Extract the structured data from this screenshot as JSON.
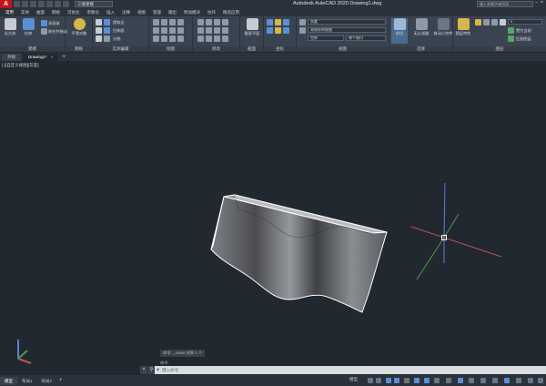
{
  "titlebar": {
    "logo": "A",
    "workspace": "三维建模",
    "title": "Autodesk AutoCAD 2020    Drawing1.dwg",
    "search_placeholder": "键入关键字或短语"
  },
  "ribbon_tabs": [
    "常用",
    "实体",
    "曲面",
    "网格",
    "可视化",
    "参数化",
    "插入",
    "注释",
    "视图",
    "管理",
    "输出",
    "附加模块",
    "协作",
    "精选应用"
  ],
  "ribbon": {
    "panels": [
      {
        "title": "建模",
        "buttons": [
          "长方体",
          "拉伸"
        ],
        "small": [
          "多段体",
          "按住并拖动"
        ]
      },
      {
        "title": "网格",
        "buttons": [
          "平滑对象"
        ]
      },
      {
        "title": "实体编辑",
        "small": [
          "提取边",
          "拉伸面",
          "分割"
        ]
      },
      {
        "title": "绘图"
      },
      {
        "title": "修改"
      },
      {
        "title": "截面",
        "buttons": [
          "截面平面"
        ]
      },
      {
        "title": "坐标"
      },
      {
        "title": "视图",
        "dropdowns": [
          "灰度",
          "未保存的视图",
          "世界",
          "单个视口"
        ]
      },
      {
        "title": "选择",
        "buttons": [
          "剖切",
          "无过滤器",
          "移动小控件"
        ]
      },
      {
        "title": "图层",
        "buttons": [
          "图层特性"
        ],
        "small": [
          "置为当前",
          "匹配图层"
        ],
        "dropdowns": [
          "0"
        ]
      }
    ]
  },
  "file_tabs": [
    {
      "label": "开始"
    },
    {
      "label": "Drawing1*",
      "close": "×"
    }
  ],
  "new_tab_symbol": "+",
  "viewport": {
    "label": "[-][自定义视图][灰度]"
  },
  "command": {
    "history_line": "命令: _.erase 找到 1 个",
    "history_line2": "命令:",
    "prompt_placeholder": "键入命令",
    "close_symbol": "×",
    "wrench_symbol": "⚲",
    "prompt_symbol": "▸"
  },
  "statusbar": {
    "tabs": [
      "模型",
      "布局1",
      "布局2"
    ],
    "add": "+",
    "model_label": "模型"
  },
  "colors": {
    "background": "#212830",
    "ribbon": "#3a4450",
    "accent_red": "#c0141b",
    "x_axis": "#c0525a",
    "y_axis": "#4f9a4f",
    "z_axis": "#5a7fd6"
  }
}
